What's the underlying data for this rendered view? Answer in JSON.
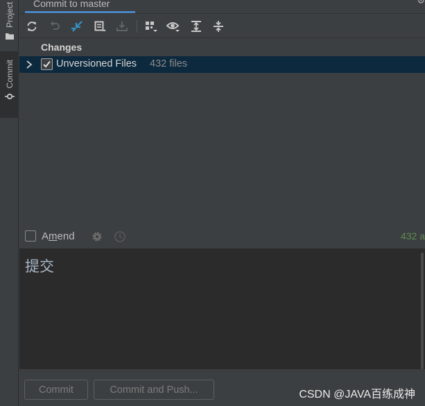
{
  "sidebar": {
    "tabs": [
      {
        "label": "Project",
        "icon": "folder-icon"
      },
      {
        "label": "Commit",
        "icon": "commit-icon"
      }
    ]
  },
  "titlebar": {
    "title": "Commit to master",
    "gear_icon": "gear-icon"
  },
  "toolbar": {
    "buttons": [
      {
        "name": "refresh",
        "icon": "refresh-icon"
      },
      {
        "name": "rollback",
        "icon": "undo-icon"
      },
      {
        "name": "diff",
        "icon": "diff-arrows-icon"
      },
      {
        "name": "shelve",
        "icon": "shelve-icon"
      },
      {
        "name": "unshelve",
        "icon": "download-icon"
      },
      {
        "name": "group-by",
        "icon": "group-by-icon"
      },
      {
        "name": "view-options",
        "icon": "eye-icon"
      },
      {
        "name": "expand-all",
        "icon": "expand-all-icon"
      },
      {
        "name": "collapse-all",
        "icon": "collapse-all-icon"
      }
    ]
  },
  "changes": {
    "header": "Changes",
    "rows": [
      {
        "label": "Unversioned Files",
        "count": "432 files",
        "checked": true,
        "selected": true
      }
    ]
  },
  "amend": {
    "label_before": "A",
    "label_mnemonic": "m",
    "label_after": "end",
    "checked": false,
    "status_right": "432 a"
  },
  "message": {
    "text": "提交"
  },
  "buttons": {
    "commit": "Commit",
    "commit_and_push": "Commit and Push..."
  },
  "watermark": "CSDN @JAVA百练成神",
  "colors": {
    "accent": "#4a88c7",
    "selection": "#0d293e",
    "status_green": "#5f8a4f"
  }
}
